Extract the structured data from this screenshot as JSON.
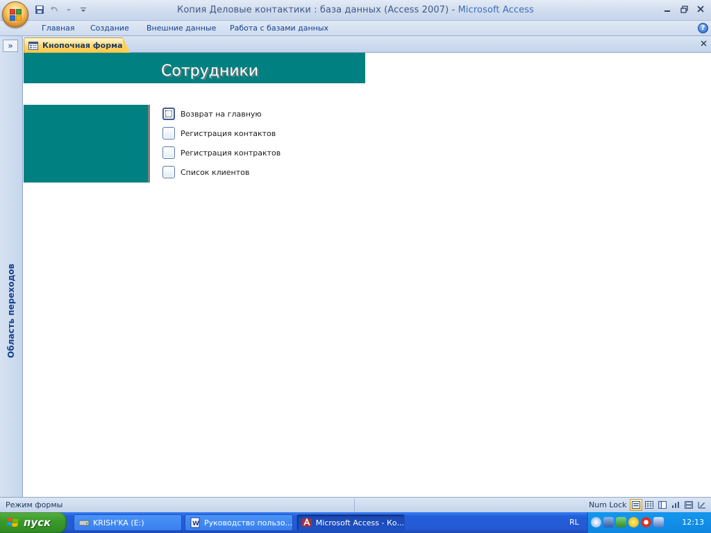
{
  "window": {
    "title_main": "Копия Деловые контактики : база данных (Access 2007)",
    "title_separator": " - ",
    "title_app": "Microsoft Access"
  },
  "ribbon": {
    "tabs": [
      "Главная",
      "Создание",
      "Внешние данные",
      "Работа с базами данных"
    ]
  },
  "navigation_pane": {
    "label": "Область переходов",
    "expand_glyph": "»"
  },
  "document_tab": {
    "label": "Кнопочная форма"
  },
  "form": {
    "title": "Сотрудники",
    "switchboard_items": [
      {
        "label": "Возврат на главную",
        "focused": true
      },
      {
        "label": "Регистрация контактов",
        "focused": false
      },
      {
        "label": "Регистрация контрактов",
        "focused": false
      },
      {
        "label": "Список клиентов",
        "focused": false
      }
    ]
  },
  "status_bar": {
    "mode": "Режим формы",
    "num_lock": "Num Lock"
  },
  "taskbar": {
    "start_label": "пуск",
    "tasks": [
      {
        "label": "KRISH'KA (E:)",
        "icon": "drive-icon",
        "active": false
      },
      {
        "label": "Руководство пользо...",
        "icon": "word-icon",
        "active": false
      },
      {
        "label": "Microsoft Access - Ко...",
        "icon": "access-icon",
        "active": true
      }
    ],
    "language": "RL",
    "clock": "12:13"
  },
  "colors": {
    "form_teal": "#008080",
    "accent_blue": "#15428b",
    "taskbar_blue": "#245edb"
  }
}
